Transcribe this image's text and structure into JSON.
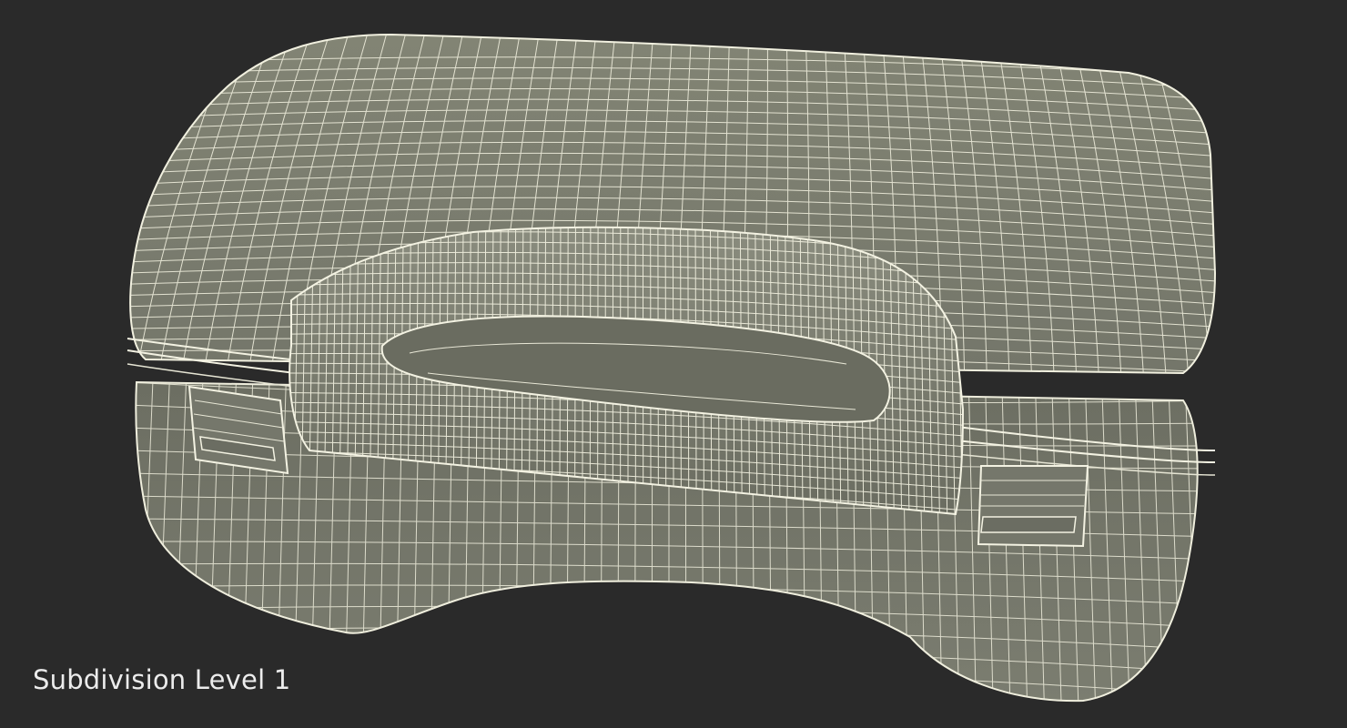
{
  "caption": "Subdivision Level 1",
  "colors": {
    "background": "#2a2a2a",
    "surface": "#77796b",
    "surface_light": "#8a8c7d",
    "surface_dark": "#5f6156",
    "wire": "#efeedd"
  }
}
